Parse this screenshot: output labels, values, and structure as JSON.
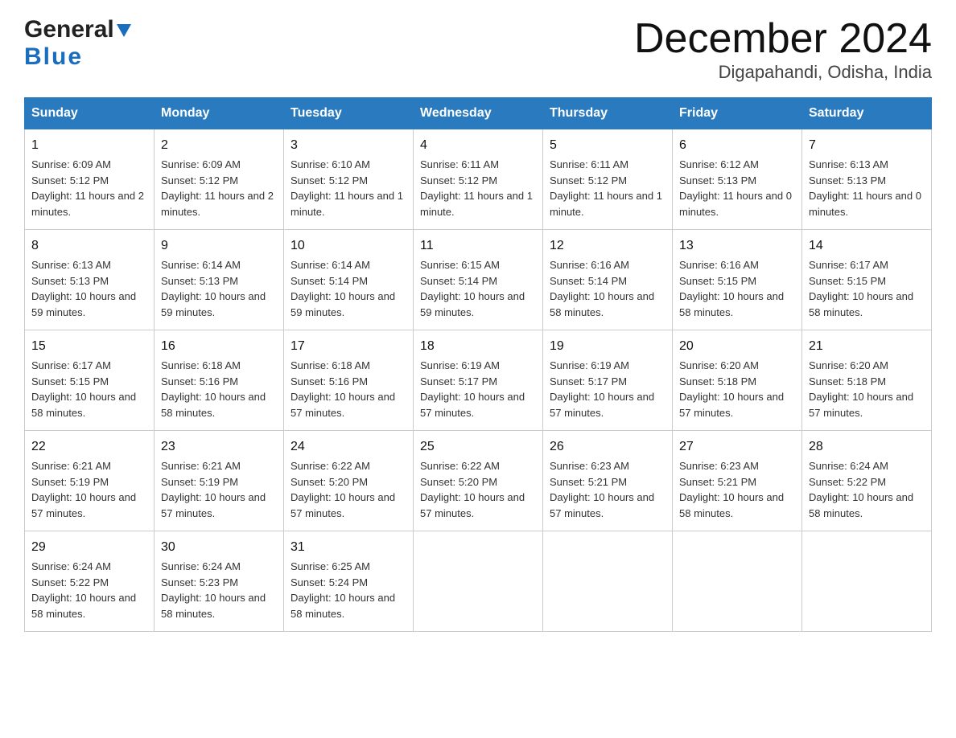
{
  "header": {
    "title": "December 2024",
    "subtitle": "Digapahandi, Odisha, India",
    "logo_general": "General",
    "logo_blue": "Blue"
  },
  "days_of_week": [
    "Sunday",
    "Monday",
    "Tuesday",
    "Wednesday",
    "Thursday",
    "Friday",
    "Saturday"
  ],
  "weeks": [
    [
      {
        "day": "1",
        "sunrise": "6:09 AM",
        "sunset": "5:12 PM",
        "daylight": "11 hours and 2 minutes."
      },
      {
        "day": "2",
        "sunrise": "6:09 AM",
        "sunset": "5:12 PM",
        "daylight": "11 hours and 2 minutes."
      },
      {
        "day": "3",
        "sunrise": "6:10 AM",
        "sunset": "5:12 PM",
        "daylight": "11 hours and 1 minute."
      },
      {
        "day": "4",
        "sunrise": "6:11 AM",
        "sunset": "5:12 PM",
        "daylight": "11 hours and 1 minute."
      },
      {
        "day": "5",
        "sunrise": "6:11 AM",
        "sunset": "5:12 PM",
        "daylight": "11 hours and 1 minute."
      },
      {
        "day": "6",
        "sunrise": "6:12 AM",
        "sunset": "5:13 PM",
        "daylight": "11 hours and 0 minutes."
      },
      {
        "day": "7",
        "sunrise": "6:13 AM",
        "sunset": "5:13 PM",
        "daylight": "11 hours and 0 minutes."
      }
    ],
    [
      {
        "day": "8",
        "sunrise": "6:13 AM",
        "sunset": "5:13 PM",
        "daylight": "10 hours and 59 minutes."
      },
      {
        "day": "9",
        "sunrise": "6:14 AM",
        "sunset": "5:13 PM",
        "daylight": "10 hours and 59 minutes."
      },
      {
        "day": "10",
        "sunrise": "6:14 AM",
        "sunset": "5:14 PM",
        "daylight": "10 hours and 59 minutes."
      },
      {
        "day": "11",
        "sunrise": "6:15 AM",
        "sunset": "5:14 PM",
        "daylight": "10 hours and 59 minutes."
      },
      {
        "day": "12",
        "sunrise": "6:16 AM",
        "sunset": "5:14 PM",
        "daylight": "10 hours and 58 minutes."
      },
      {
        "day": "13",
        "sunrise": "6:16 AM",
        "sunset": "5:15 PM",
        "daylight": "10 hours and 58 minutes."
      },
      {
        "day": "14",
        "sunrise": "6:17 AM",
        "sunset": "5:15 PM",
        "daylight": "10 hours and 58 minutes."
      }
    ],
    [
      {
        "day": "15",
        "sunrise": "6:17 AM",
        "sunset": "5:15 PM",
        "daylight": "10 hours and 58 minutes."
      },
      {
        "day": "16",
        "sunrise": "6:18 AM",
        "sunset": "5:16 PM",
        "daylight": "10 hours and 58 minutes."
      },
      {
        "day": "17",
        "sunrise": "6:18 AM",
        "sunset": "5:16 PM",
        "daylight": "10 hours and 57 minutes."
      },
      {
        "day": "18",
        "sunrise": "6:19 AM",
        "sunset": "5:17 PM",
        "daylight": "10 hours and 57 minutes."
      },
      {
        "day": "19",
        "sunrise": "6:19 AM",
        "sunset": "5:17 PM",
        "daylight": "10 hours and 57 minutes."
      },
      {
        "day": "20",
        "sunrise": "6:20 AM",
        "sunset": "5:18 PM",
        "daylight": "10 hours and 57 minutes."
      },
      {
        "day": "21",
        "sunrise": "6:20 AM",
        "sunset": "5:18 PM",
        "daylight": "10 hours and 57 minutes."
      }
    ],
    [
      {
        "day": "22",
        "sunrise": "6:21 AM",
        "sunset": "5:19 PM",
        "daylight": "10 hours and 57 minutes."
      },
      {
        "day": "23",
        "sunrise": "6:21 AM",
        "sunset": "5:19 PM",
        "daylight": "10 hours and 57 minutes."
      },
      {
        "day": "24",
        "sunrise": "6:22 AM",
        "sunset": "5:20 PM",
        "daylight": "10 hours and 57 minutes."
      },
      {
        "day": "25",
        "sunrise": "6:22 AM",
        "sunset": "5:20 PM",
        "daylight": "10 hours and 57 minutes."
      },
      {
        "day": "26",
        "sunrise": "6:23 AM",
        "sunset": "5:21 PM",
        "daylight": "10 hours and 57 minutes."
      },
      {
        "day": "27",
        "sunrise": "6:23 AM",
        "sunset": "5:21 PM",
        "daylight": "10 hours and 58 minutes."
      },
      {
        "day": "28",
        "sunrise": "6:24 AM",
        "sunset": "5:22 PM",
        "daylight": "10 hours and 58 minutes."
      }
    ],
    [
      {
        "day": "29",
        "sunrise": "6:24 AM",
        "sunset": "5:22 PM",
        "daylight": "10 hours and 58 minutes."
      },
      {
        "day": "30",
        "sunrise": "6:24 AM",
        "sunset": "5:23 PM",
        "daylight": "10 hours and 58 minutes."
      },
      {
        "day": "31",
        "sunrise": "6:25 AM",
        "sunset": "5:24 PM",
        "daylight": "10 hours and 58 minutes."
      },
      null,
      null,
      null,
      null
    ]
  ]
}
